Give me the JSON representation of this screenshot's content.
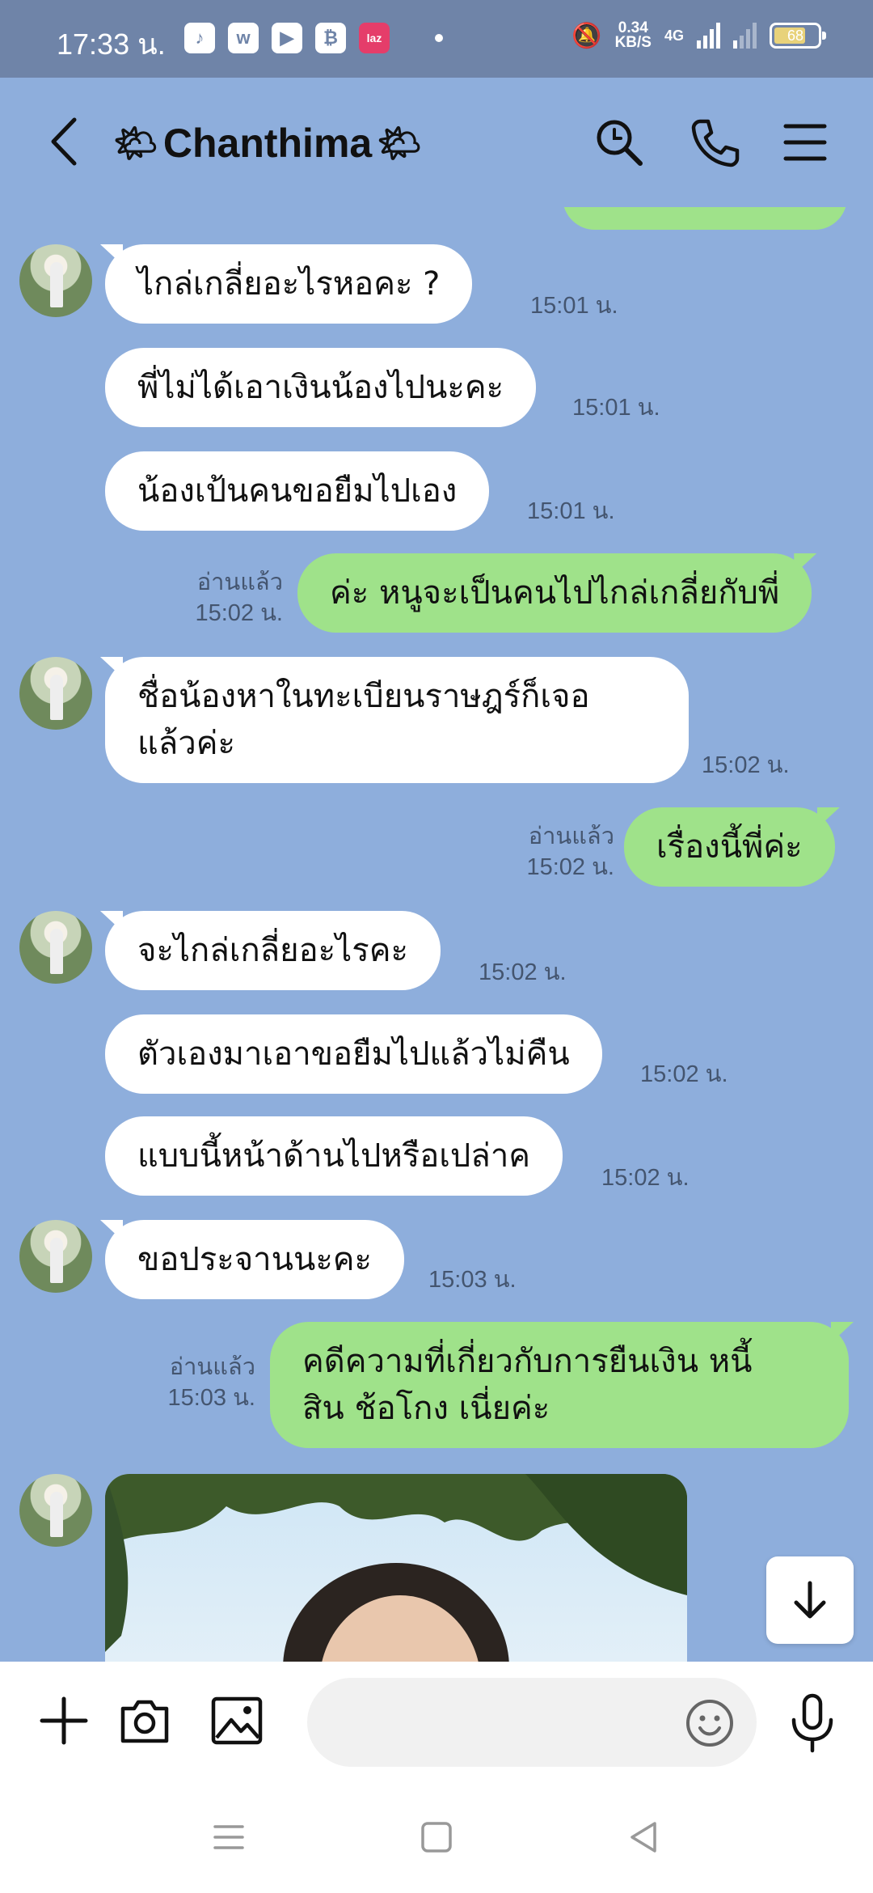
{
  "status_bar": {
    "time": "17:33 น.",
    "app_icons": [
      "tiktok-icon",
      "w-icon",
      "youtube-icon",
      "lazada-b-icon",
      "laz-icon"
    ],
    "icon_glyphs": [
      "♪",
      "w",
      "▶",
      "₿",
      "laz"
    ],
    "speed_value": "0.34",
    "speed_unit": "KB/S",
    "network": "4G",
    "battery": "68"
  },
  "header": {
    "contact_name": "Chanthima",
    "sun_left": "🌤",
    "sun_right": "🌤"
  },
  "messages": [
    {
      "dir": "in",
      "text": "ไกล่เกลี่ยอะไรหอคะ ?",
      "time": "15:01 น."
    },
    {
      "dir": "in",
      "text": "พี่ไม่ได้เอาเงินน้องไปนะคะ",
      "time": "15:01 น."
    },
    {
      "dir": "in",
      "text": "น้องเป้นคนขอยืมไปเอง",
      "time": "15:01 น."
    },
    {
      "dir": "out",
      "text": "ค่ะ หนูจะเป็นคนไปไกล่เกลี่ยกับพี่",
      "read": "อ่านแล้ว",
      "time": "15:02 น."
    },
    {
      "dir": "in",
      "text": "ชื่อน้องหาในทะเบียนราษฎร์ก็เจอ\nแล้วค่ะ",
      "time": "15:02 น."
    },
    {
      "dir": "out",
      "text": "เรื่องนี้พี่ค่ะ",
      "read": "อ่านแล้ว",
      "time": "15:02 น."
    },
    {
      "dir": "in",
      "text": "จะไกล่เกลี่ยอะไรคะ",
      "time": "15:02 น."
    },
    {
      "dir": "in",
      "text": "ตัวเองมาเอาขอยืมไปแล้วไม่คืน",
      "time": "15:02 น."
    },
    {
      "dir": "in",
      "text": "แบบนี้หน้าด้านไปหรือเปล่าค",
      "time": "15:02 น."
    },
    {
      "dir": "in",
      "text": "ขอประจานนะคะ",
      "time": "15:03 น."
    },
    {
      "dir": "out",
      "text": "คดีความที่เกี่ยวกับการยืนเงิน หนี้\nสิน ช้อโกง เนี่ยค่ะ",
      "read": "อ่านแล้ว",
      "time": "15:03 น."
    }
  ],
  "input": {
    "placeholder": ""
  }
}
